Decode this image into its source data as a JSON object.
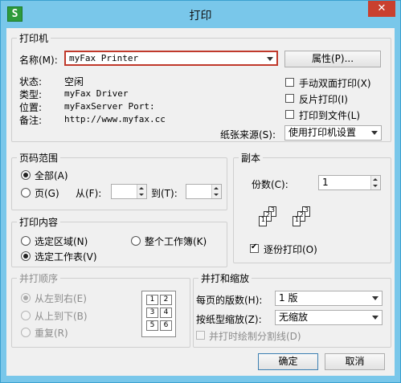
{
  "window": {
    "title": "打印",
    "close": "✕",
    "app_icon": "S"
  },
  "printer": {
    "group_title": "打印机",
    "name_label": "名称(M):",
    "name_value": "myFax Printer",
    "properties_button": "属性(P)...",
    "status_label": "状态:",
    "status_value": "空闲",
    "type_label": "类型:",
    "type_value": "myFax Driver",
    "location_label": "位置:",
    "location_value": "myFaxServer Port:",
    "comment_label": "备注:",
    "comment_value": "http://www.myfax.cc",
    "duplex_label": "手动双面打印(X)",
    "duplex_checked": false,
    "reverse_label": "反片打印(I)",
    "reverse_checked": false,
    "to_file_label": "打印到文件(L)",
    "to_file_checked": false,
    "paper_source_label": "纸张来源(S):",
    "paper_source_value": "使用打印机设置"
  },
  "page_range": {
    "group_title": "页码范围",
    "all_label": "全部(A)",
    "all_selected": true,
    "pages_label": "页(G)",
    "from_label": "从(F):",
    "from_value": "",
    "to_label": "到(T):",
    "to_value": ""
  },
  "copies": {
    "group_title": "副本",
    "count_label": "份数(C):",
    "count_value": "1",
    "collate_label": "逐份打印(O)",
    "collate_checked": true
  },
  "print_what": {
    "group_title": "打印内容",
    "selection_label": "选定区域(N)",
    "workbook_label": "整个工作簿(K)",
    "sheet_label": "选定工作表(V)",
    "sheet_selected": true
  },
  "order": {
    "group_title": "并打顺序",
    "ltr_label": "从左到右(E)",
    "ltr_selected": true,
    "ttb_label": "从上到下(B)",
    "repeat_label": "重复(R)",
    "grid_numbers": [
      "1",
      "2",
      "3",
      "4",
      "5",
      "6"
    ]
  },
  "zoom": {
    "group_title": "并打和缩放",
    "per_page_label": "每页的版数(H):",
    "per_page_value": "1 版",
    "scale_label": "按纸型缩放(Z):",
    "scale_value": "无缩放",
    "draw_lines_label": "并打时绘制分割线(D)",
    "draw_lines_checked": false
  },
  "buttons": {
    "ok": "确定",
    "cancel": "取消"
  }
}
